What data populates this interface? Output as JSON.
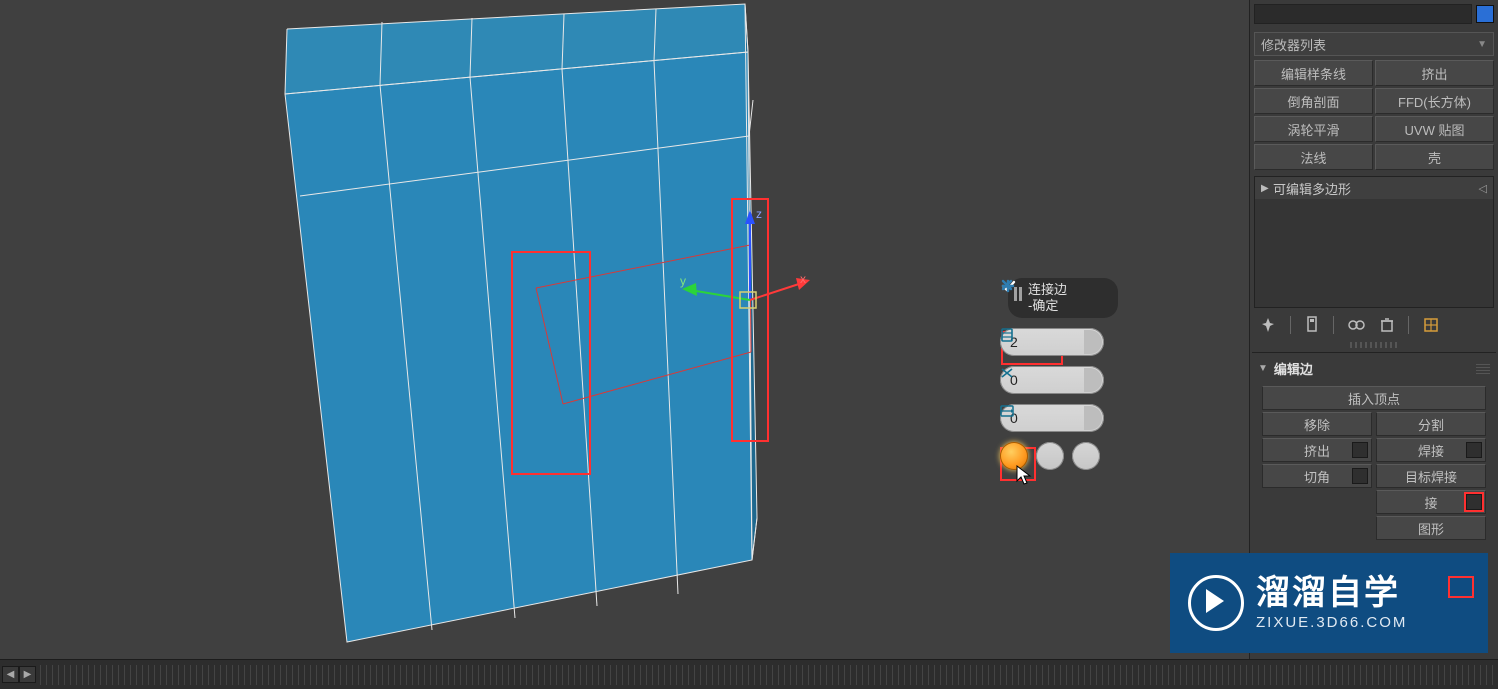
{
  "viewport": {
    "gizmo_axes": {
      "x": "x",
      "y": "y",
      "z": "z"
    }
  },
  "caddy": {
    "title_line1": "连接边",
    "title_line2": "-确定",
    "segments": "2",
    "pinch": "0",
    "slide": "0"
  },
  "side": {
    "object_name": "",
    "modifier_list_label": "修改器列表",
    "quick_buttons": {
      "edit_spline": "编辑样条线",
      "extrude": "挤出",
      "chamfer_profile": "倒角剖面",
      "ffd_box": "FFD(长方体)",
      "turbosmooth": "涡轮平滑",
      "uvw_map": "UVW 贴图",
      "normal": "法线",
      "shell": "壳"
    },
    "stack_item": "可编辑多边形",
    "rollout_title": "编辑边",
    "insert_vertex": "插入顶点",
    "remove": "移除",
    "split": "分割",
    "extrude_btn": "挤出",
    "weld": "焊接",
    "chamfer": "切角",
    "target_weld": "目标焊接",
    "connect_suffix": "接",
    "shape_suffix": "图形"
  },
  "watermark": {
    "title": "溜溜自学",
    "subtitle": "ZIXUE.3D66.COM"
  }
}
